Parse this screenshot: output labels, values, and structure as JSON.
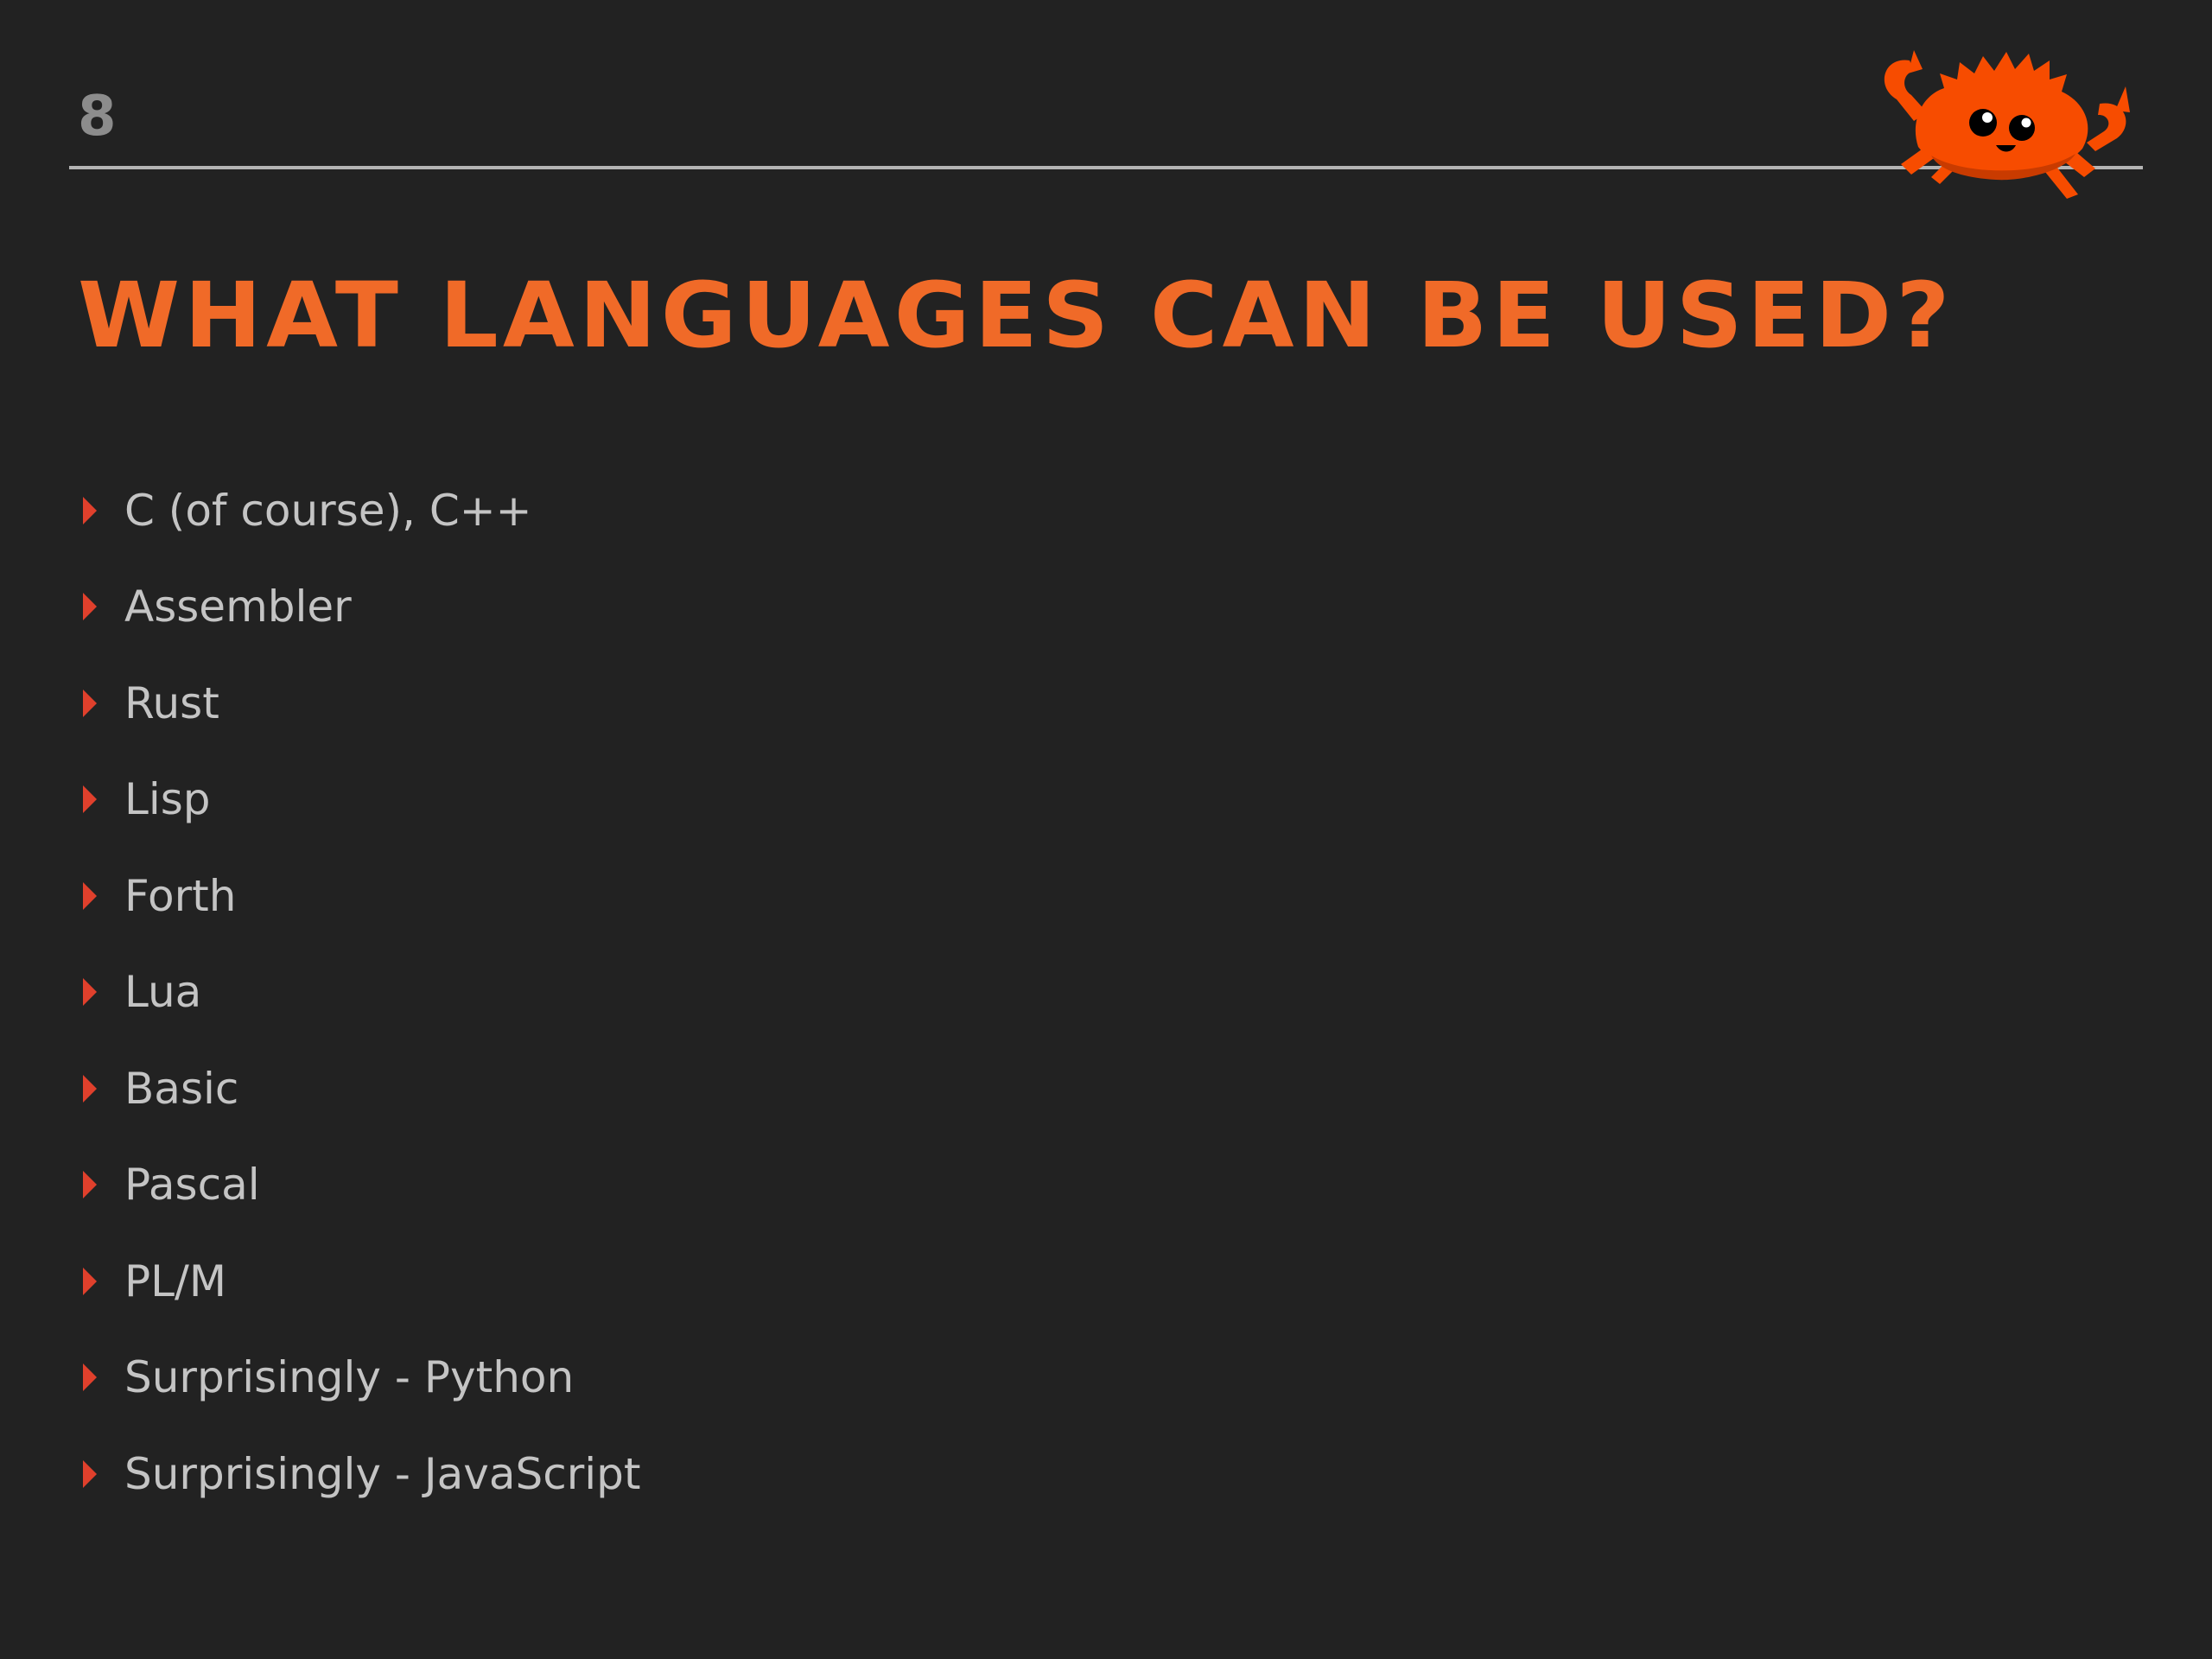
{
  "slide": {
    "number": "8",
    "title": "WHAT LANGUAGES CAN BE USED?",
    "mascot_icon": "rust-crab-ferris-icon",
    "colors": {
      "background": "#222222",
      "title": "#f06a28",
      "text": "#c4c4c4",
      "bullet": "#e0402c",
      "rule": "#b4b4b4",
      "mascot": "#f74c00"
    },
    "items": [
      {
        "label": "C (of course), C++"
      },
      {
        "label": "Assembler"
      },
      {
        "label": "Rust"
      },
      {
        "label": "Lisp"
      },
      {
        "label": "Forth"
      },
      {
        "label": "Lua"
      },
      {
        "label": "Basic"
      },
      {
        "label": "Pascal"
      },
      {
        "label": "PL/M"
      },
      {
        "label": "Surprisingly - Python"
      },
      {
        "label": "Surprisingly - JavaScript"
      }
    ]
  }
}
